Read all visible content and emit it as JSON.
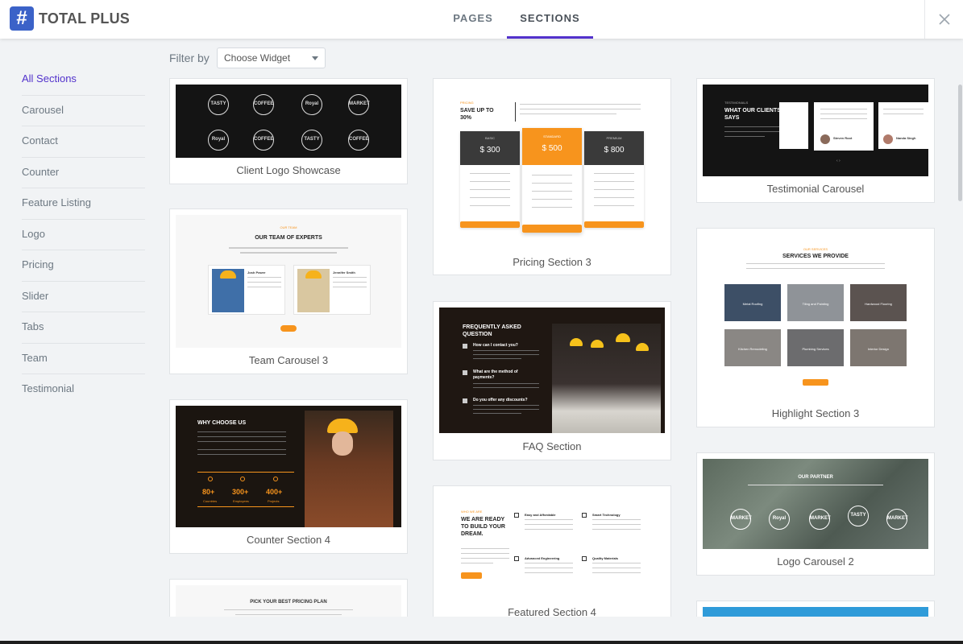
{
  "header": {
    "brand": "TOTAL PLUS",
    "tabs": [
      "PAGES",
      "SECTIONS"
    ],
    "active_tab": "SECTIONS"
  },
  "sidebar": {
    "items": [
      "All Sections",
      "Carousel",
      "Contact",
      "Counter",
      "Feature Listing",
      "Logo",
      "Pricing",
      "Slider",
      "Tabs",
      "Team",
      "Testimonial"
    ],
    "active": "All Sections"
  },
  "filter": {
    "label": "Filter by",
    "selected": "Choose Widget"
  },
  "colors": {
    "accent": "#5232cc",
    "logo": "#3b62c8",
    "orange": "#f7941d"
  },
  "cards": {
    "client_logo": {
      "title": "Client Logo Showcase",
      "logos": [
        "TASTY",
        "COFFEE",
        "Royal",
        "MARKET",
        "Royal",
        "COFFEE",
        "TASTY",
        "COFFEE"
      ]
    },
    "team_carousel": {
      "title": "Team Carousel 3",
      "tag": "OUR TEAM",
      "heading": "OUR TEAM OF EXPERTS",
      "members": [
        "Josh Power",
        "Jennifer Smith"
      ]
    },
    "counter": {
      "title": "Counter Section 4",
      "heading": "WHY CHOOSE US",
      "stats": [
        {
          "value": "80+",
          "label": "Countries"
        },
        {
          "value": "300+",
          "label": "Employees"
        },
        {
          "value": "400+",
          "label": "Projects"
        }
      ]
    },
    "pricing_plan": {
      "heading": "PICK YOUR BEST PRICING PLAN"
    },
    "pricing": {
      "title": "Pricing Section 3",
      "tag": "PRICING",
      "heading": "SAVE UP TO 30%",
      "plans": [
        {
          "name": "BASIC",
          "price": "$ 300"
        },
        {
          "name": "STANDARD",
          "price": "$ 500"
        },
        {
          "name": "PREMIUM",
          "price": "$ 800"
        }
      ]
    },
    "faq": {
      "title": "FAQ Section",
      "heading": "FREQUENTLY ASKED QUESTION",
      "questions": [
        "How can I contact you?",
        "What are the method of payments?",
        "Do you offer any discounts?"
      ]
    },
    "featured": {
      "title": "Featured Section 4",
      "tag": "WHO WE ARE",
      "heading": "WE ARE READY TO BUILD YOUR DREAM.",
      "features": [
        "Easy and Affordable",
        "Smart Technology",
        "Advanced Engineering",
        "Quality Materials"
      ]
    },
    "testimonial": {
      "title": "Testimonial Carousel",
      "tag": "TESTIMONIALS",
      "heading": "WHAT OUR CLIENTS SAYS",
      "names": [
        "Steven Root",
        "Nanda Singh"
      ]
    },
    "highlight": {
      "title": "Highlight Section 3",
      "tag": "OUR SERVICES",
      "heading": "SERVICES WE PROVIDE",
      "services": [
        "Metal Roofing",
        "Tiling and Painting",
        "Hardwood Flooring",
        "Kitchen Remodeling",
        "Plumbing Services",
        "Interior Design"
      ]
    },
    "logo_carousel": {
      "title": "Logo Carousel 2",
      "heading": "OUR PARTNER",
      "logos": [
        "MARKET",
        "Royal",
        "MARKET",
        "TASTY",
        "MARKET"
      ]
    }
  }
}
